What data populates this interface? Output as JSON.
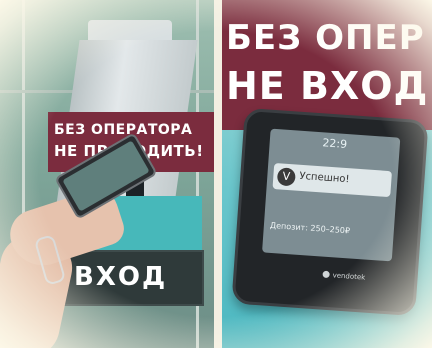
{
  "left_photo": {
    "operator_sign": {
      "line1": "БЕЗ ОПЕРАТОРА",
      "line2": "НЕ ПРОХОДИТЬ!"
    },
    "entrance_sign": "ВХОД"
  },
  "right_photo": {
    "big_sign": {
      "line1": "БЕЗ ОПЕР",
      "line2": "НЕ ВХОД"
    },
    "terminal": {
      "clock": "22:9",
      "status": "Успешно!",
      "deposit_text": "Депозит: 250–250₽",
      "brand": "vendotek"
    }
  },
  "colors": {
    "sign_maroon": "#7b2c3e",
    "turnstile_teal": "#47b8ba",
    "frame_cream": "#fbf6e6"
  }
}
